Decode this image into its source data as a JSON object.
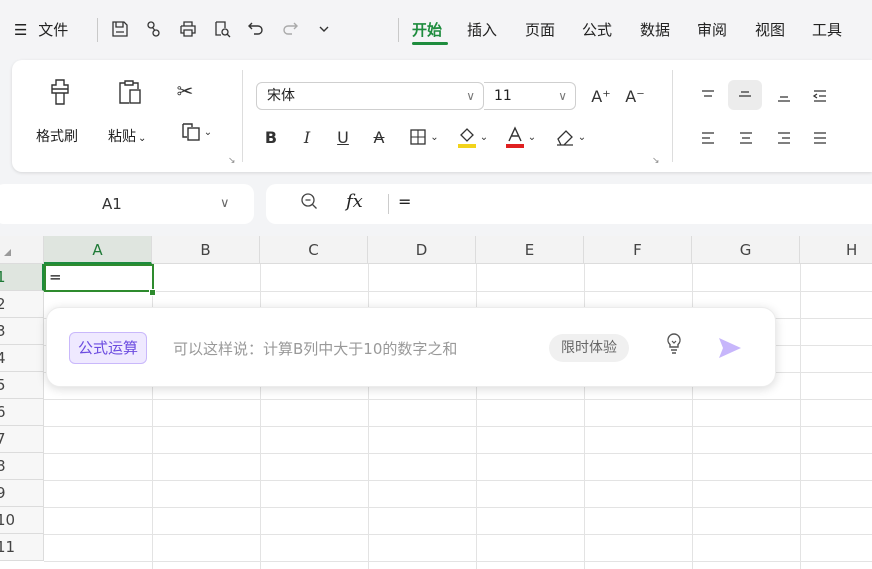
{
  "menubar": {
    "hamburger": "☰",
    "file": "文件",
    "tabs": [
      "开始",
      "插入",
      "页面",
      "公式",
      "数据",
      "审阅",
      "视图",
      "工具"
    ],
    "active_tab": "开始"
  },
  "ribbon": {
    "format_painter": "格式刷",
    "paste": "粘贴",
    "font_name": "宋体",
    "font_size": "11",
    "bold": "B",
    "italic": "I",
    "underline": "U",
    "strikethrough": "A",
    "font_color_letter": "A",
    "grow_font": "A⁺",
    "shrink_font": "A⁻"
  },
  "formula_bar": {
    "cell_ref": "A1",
    "fx": "fx",
    "value": "="
  },
  "sheet": {
    "columns": [
      "A",
      "B",
      "C",
      "D",
      "E",
      "F",
      "G",
      "H"
    ],
    "rows": [
      "1",
      "2",
      "3",
      "4",
      "5",
      "6",
      "7",
      "8",
      "9",
      "10",
      "11"
    ],
    "selected_column": "A",
    "selected_row": "1",
    "active_cell_value": "="
  },
  "ai_popup": {
    "chip": "公式运算",
    "placeholder": "可以这样说：计算B列中大于10的数字之和",
    "trial_badge": "限时体验"
  },
  "colors": {
    "accent": "#1e8c3e",
    "ai_purple": "#6c4ce0",
    "font_color_bar": "#e02020",
    "highlight_bar": "#f2d31b"
  }
}
